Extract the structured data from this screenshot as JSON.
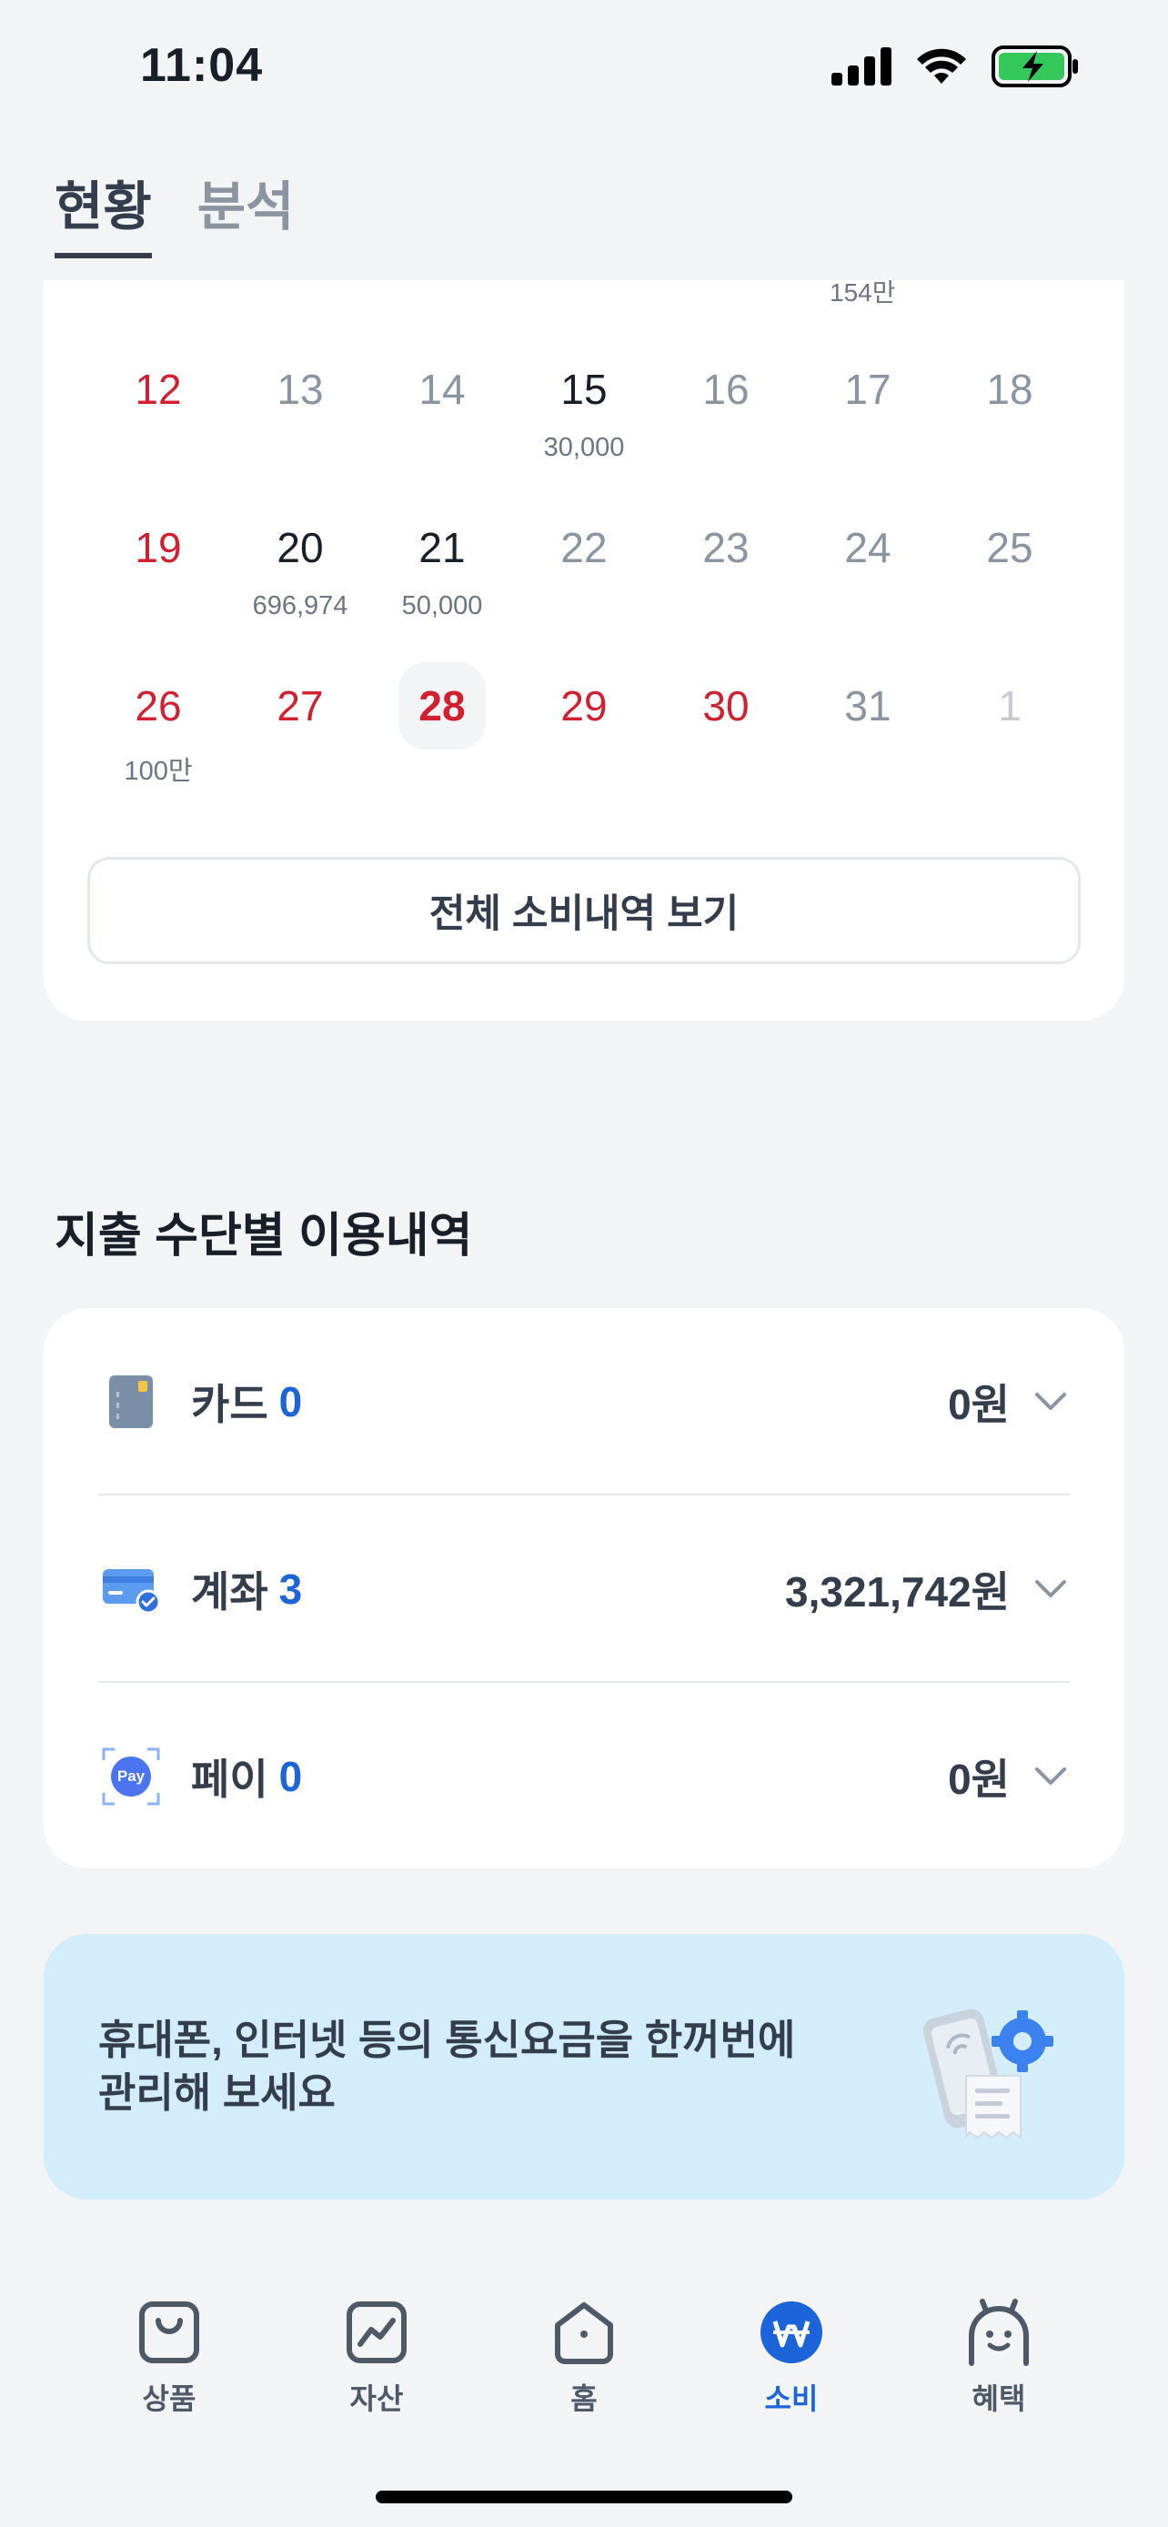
{
  "status_bar": {
    "time": "11:04"
  },
  "top_tabs": [
    {
      "label": "현황",
      "active": true
    },
    {
      "label": "분석",
      "active": false
    }
  ],
  "calendar": {
    "cut_label": "154만",
    "rows": [
      [
        {
          "day": "12",
          "color": "red",
          "amount": ""
        },
        {
          "day": "13",
          "color": "gray",
          "amount": ""
        },
        {
          "day": "14",
          "color": "gray",
          "amount": ""
        },
        {
          "day": "15",
          "color": "black",
          "amount": "30,000"
        },
        {
          "day": "16",
          "color": "gray",
          "amount": ""
        },
        {
          "day": "17",
          "color": "gray",
          "amount": ""
        },
        {
          "day": "18",
          "color": "gray",
          "amount": ""
        }
      ],
      [
        {
          "day": "19",
          "color": "red",
          "amount": ""
        },
        {
          "day": "20",
          "color": "black",
          "amount": "696,974"
        },
        {
          "day": "21",
          "color": "black",
          "amount": "50,000"
        },
        {
          "day": "22",
          "color": "gray",
          "amount": ""
        },
        {
          "day": "23",
          "color": "gray",
          "amount": ""
        },
        {
          "day": "24",
          "color": "gray",
          "amount": ""
        },
        {
          "day": "25",
          "color": "gray",
          "amount": ""
        }
      ],
      [
        {
          "day": "26",
          "color": "red",
          "amount": "100만"
        },
        {
          "day": "27",
          "color": "red",
          "amount": ""
        },
        {
          "day": "28",
          "color": "red",
          "amount": "",
          "today": true
        },
        {
          "day": "29",
          "color": "red",
          "amount": ""
        },
        {
          "day": "30",
          "color": "red",
          "amount": ""
        },
        {
          "day": "31",
          "color": "gray",
          "amount": ""
        },
        {
          "day": "1",
          "color": "light",
          "amount": ""
        }
      ]
    ],
    "full_button_label": "전체 소비내역 보기"
  },
  "methods": {
    "title": "지출 수단별 이용내역",
    "items": [
      {
        "label": "카드",
        "count": "0",
        "amount": "0원",
        "icon": "card-icon"
      },
      {
        "label": "계좌",
        "count": "3",
        "amount": "3,321,742원",
        "icon": "account-icon"
      },
      {
        "label": "페이",
        "count": "0",
        "amount": "0원",
        "icon": "pay-icon",
        "icon_text": "Pay"
      }
    ]
  },
  "banner": {
    "line1": "휴대폰, 인터넷 등의 통신요금을 한꺼번에",
    "line2": "관리해 보세요"
  },
  "tab_bar": [
    {
      "label": "상품",
      "icon": "bag-icon",
      "active": false
    },
    {
      "label": "자산",
      "icon": "chart-icon",
      "active": false
    },
    {
      "label": "홈",
      "icon": "home-icon",
      "active": false
    },
    {
      "label": "소비",
      "icon": "won-icon",
      "active": true
    },
    {
      "label": "혜택",
      "icon": "benefit-icon",
      "active": false
    }
  ],
  "colors": {
    "accent": "#1b64da",
    "weekend_red": "#d22030",
    "banner_bg": "#d4edfb"
  }
}
